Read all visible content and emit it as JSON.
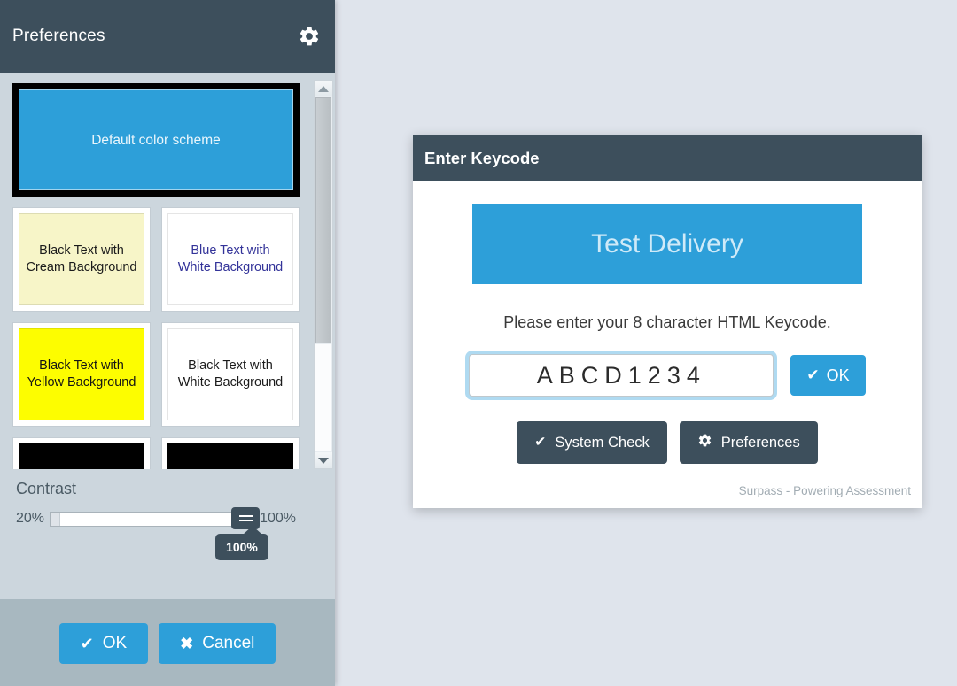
{
  "preferences_panel": {
    "title": "Preferences",
    "gear_icon": "gear-icon",
    "color_schemes": [
      {
        "label": "Default color scheme",
        "bg": "#2d9fd9",
        "fg": "#eaf6fc",
        "selected": true,
        "span": "wide"
      },
      {
        "label": "Black Text with Cream Background",
        "bg": "#f7f5c8",
        "fg": "#1b1b1b",
        "selected": false,
        "span": "half"
      },
      {
        "label": "Blue Text with White Background",
        "bg": "#ffffff",
        "fg": "#333399",
        "selected": false,
        "span": "half"
      },
      {
        "label": "Black Text with Yellow Background",
        "bg": "#fdfd00",
        "fg": "#141414",
        "selected": false,
        "span": "half"
      },
      {
        "label": "Black Text with White Background",
        "bg": "#ffffff",
        "fg": "#1b1b1b",
        "selected": false,
        "span": "half"
      },
      {
        "label": "",
        "bg": "#000000",
        "fg": "#ffffff",
        "selected": false,
        "span": "half"
      },
      {
        "label": "",
        "bg": "#000000",
        "fg": "#ffffff",
        "selected": false,
        "span": "half"
      }
    ],
    "scrollbar": {
      "up_arrow": "scroll-up-arrow-icon",
      "down_arrow": "scroll-down-arrow-icon"
    },
    "contrast": {
      "label": "Contrast",
      "min_label": "20%",
      "max_label": "100%",
      "value_tooltip": "100%",
      "value": 100
    },
    "footer": {
      "ok_label": "OK",
      "cancel_label": "Cancel",
      "ok_icon": "check-icon",
      "cancel_icon": "x-icon"
    }
  },
  "keycode_dialog": {
    "title": "Enter Keycode",
    "banner_text": "Test Delivery",
    "instruction": "Please enter your 8 character HTML Keycode.",
    "keycode_value": "ABCD1234",
    "keycode_placeholder": "",
    "ok_label": "OK",
    "ok_icon": "check-icon",
    "system_check_label": "System Check",
    "system_check_icon": "check-icon",
    "preferences_label": "Preferences",
    "preferences_icon": "gear-icon",
    "footer_text": "Surpass - Powering Assessment"
  },
  "colors": {
    "accent_blue": "#2d9fd9",
    "dark_slate": "#3d4f5c",
    "page_background": "#dfe4ec",
    "panel_background": "#ccd6dd",
    "panel_footer": "#a8b8c0"
  }
}
